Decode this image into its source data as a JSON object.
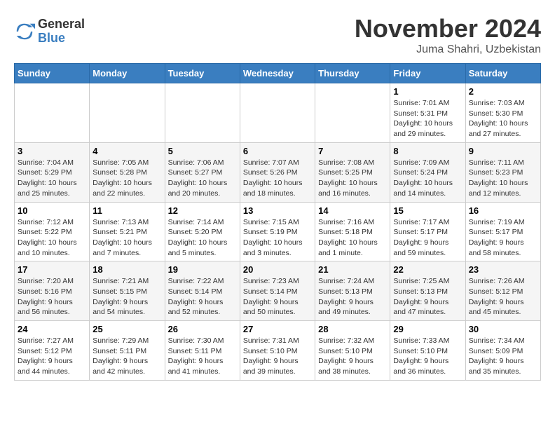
{
  "header": {
    "logo_general": "General",
    "logo_blue": "Blue",
    "month_title": "November 2024",
    "location": "Juma Shahri, Uzbekistan"
  },
  "weekdays": [
    "Sunday",
    "Monday",
    "Tuesday",
    "Wednesday",
    "Thursday",
    "Friday",
    "Saturday"
  ],
  "weeks": [
    [
      {
        "day": "",
        "info": ""
      },
      {
        "day": "",
        "info": ""
      },
      {
        "day": "",
        "info": ""
      },
      {
        "day": "",
        "info": ""
      },
      {
        "day": "",
        "info": ""
      },
      {
        "day": "1",
        "info": "Sunrise: 7:01 AM\nSunset: 5:31 PM\nDaylight: 10 hours\nand 29 minutes."
      },
      {
        "day": "2",
        "info": "Sunrise: 7:03 AM\nSunset: 5:30 PM\nDaylight: 10 hours\nand 27 minutes."
      }
    ],
    [
      {
        "day": "3",
        "info": "Sunrise: 7:04 AM\nSunset: 5:29 PM\nDaylight: 10 hours\nand 25 minutes."
      },
      {
        "day": "4",
        "info": "Sunrise: 7:05 AM\nSunset: 5:28 PM\nDaylight: 10 hours\nand 22 minutes."
      },
      {
        "day": "5",
        "info": "Sunrise: 7:06 AM\nSunset: 5:27 PM\nDaylight: 10 hours\nand 20 minutes."
      },
      {
        "day": "6",
        "info": "Sunrise: 7:07 AM\nSunset: 5:26 PM\nDaylight: 10 hours\nand 18 minutes."
      },
      {
        "day": "7",
        "info": "Sunrise: 7:08 AM\nSunset: 5:25 PM\nDaylight: 10 hours\nand 16 minutes."
      },
      {
        "day": "8",
        "info": "Sunrise: 7:09 AM\nSunset: 5:24 PM\nDaylight: 10 hours\nand 14 minutes."
      },
      {
        "day": "9",
        "info": "Sunrise: 7:11 AM\nSunset: 5:23 PM\nDaylight: 10 hours\nand 12 minutes."
      }
    ],
    [
      {
        "day": "10",
        "info": "Sunrise: 7:12 AM\nSunset: 5:22 PM\nDaylight: 10 hours\nand 10 minutes."
      },
      {
        "day": "11",
        "info": "Sunrise: 7:13 AM\nSunset: 5:21 PM\nDaylight: 10 hours\nand 7 minutes."
      },
      {
        "day": "12",
        "info": "Sunrise: 7:14 AM\nSunset: 5:20 PM\nDaylight: 10 hours\nand 5 minutes."
      },
      {
        "day": "13",
        "info": "Sunrise: 7:15 AM\nSunset: 5:19 PM\nDaylight: 10 hours\nand 3 minutes."
      },
      {
        "day": "14",
        "info": "Sunrise: 7:16 AM\nSunset: 5:18 PM\nDaylight: 10 hours\nand 1 minute."
      },
      {
        "day": "15",
        "info": "Sunrise: 7:17 AM\nSunset: 5:17 PM\nDaylight: 9 hours\nand 59 minutes."
      },
      {
        "day": "16",
        "info": "Sunrise: 7:19 AM\nSunset: 5:17 PM\nDaylight: 9 hours\nand 58 minutes."
      }
    ],
    [
      {
        "day": "17",
        "info": "Sunrise: 7:20 AM\nSunset: 5:16 PM\nDaylight: 9 hours\nand 56 minutes."
      },
      {
        "day": "18",
        "info": "Sunrise: 7:21 AM\nSunset: 5:15 PM\nDaylight: 9 hours\nand 54 minutes."
      },
      {
        "day": "19",
        "info": "Sunrise: 7:22 AM\nSunset: 5:14 PM\nDaylight: 9 hours\nand 52 minutes."
      },
      {
        "day": "20",
        "info": "Sunrise: 7:23 AM\nSunset: 5:14 PM\nDaylight: 9 hours\nand 50 minutes."
      },
      {
        "day": "21",
        "info": "Sunrise: 7:24 AM\nSunset: 5:13 PM\nDaylight: 9 hours\nand 49 minutes."
      },
      {
        "day": "22",
        "info": "Sunrise: 7:25 AM\nSunset: 5:13 PM\nDaylight: 9 hours\nand 47 minutes."
      },
      {
        "day": "23",
        "info": "Sunrise: 7:26 AM\nSunset: 5:12 PM\nDaylight: 9 hours\nand 45 minutes."
      }
    ],
    [
      {
        "day": "24",
        "info": "Sunrise: 7:27 AM\nSunset: 5:12 PM\nDaylight: 9 hours\nand 44 minutes."
      },
      {
        "day": "25",
        "info": "Sunrise: 7:29 AM\nSunset: 5:11 PM\nDaylight: 9 hours\nand 42 minutes."
      },
      {
        "day": "26",
        "info": "Sunrise: 7:30 AM\nSunset: 5:11 PM\nDaylight: 9 hours\nand 41 minutes."
      },
      {
        "day": "27",
        "info": "Sunrise: 7:31 AM\nSunset: 5:10 PM\nDaylight: 9 hours\nand 39 minutes."
      },
      {
        "day": "28",
        "info": "Sunrise: 7:32 AM\nSunset: 5:10 PM\nDaylight: 9 hours\nand 38 minutes."
      },
      {
        "day": "29",
        "info": "Sunrise: 7:33 AM\nSunset: 5:10 PM\nDaylight: 9 hours\nand 36 minutes."
      },
      {
        "day": "30",
        "info": "Sunrise: 7:34 AM\nSunset: 5:09 PM\nDaylight: 9 hours\nand 35 minutes."
      }
    ]
  ]
}
